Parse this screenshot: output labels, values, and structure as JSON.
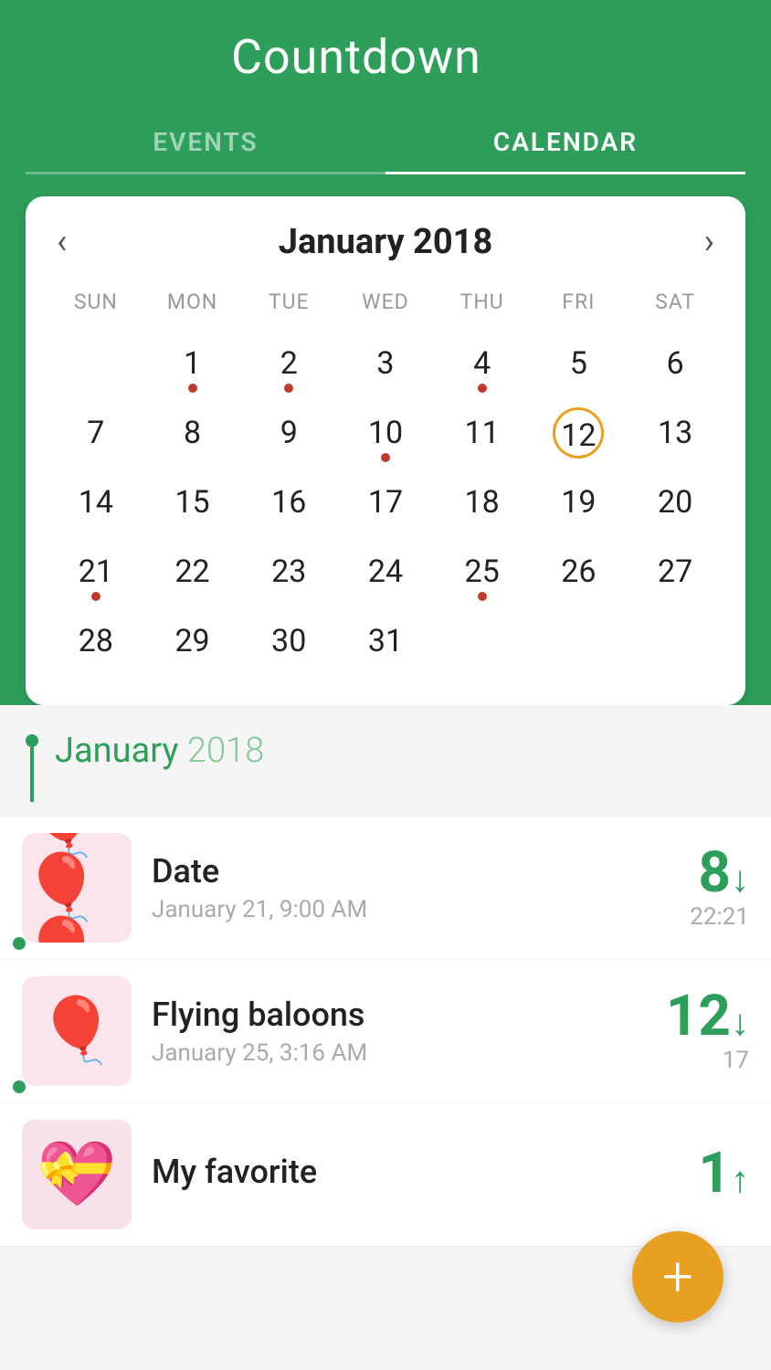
{
  "header": {
    "title": "Countdown",
    "icon_hamburger": "☰",
    "icon_check_cloud": "✓",
    "icon_palette": "🎨",
    "icon_filter": "≡"
  },
  "tabs": [
    {
      "id": "events",
      "label": "EVENTS",
      "active": false
    },
    {
      "id": "calendar",
      "label": "CALENDAR",
      "active": true
    }
  ],
  "calendar": {
    "month_title": "January 2018",
    "prev_label": "‹",
    "next_label": "›",
    "weekdays": [
      "SUN",
      "MON",
      "TUE",
      "WED",
      "THU",
      "FRI",
      "SAT"
    ],
    "today_day": 12,
    "weeks": [
      [
        null,
        1,
        2,
        3,
        4,
        5,
        6
      ],
      [
        7,
        8,
        9,
        10,
        11,
        12,
        13
      ],
      [
        14,
        15,
        16,
        17,
        18,
        19,
        20
      ],
      [
        21,
        22,
        23,
        24,
        25,
        26,
        27
      ],
      [
        28,
        29,
        30,
        31,
        null,
        null,
        null
      ]
    ],
    "dots": [
      1,
      2,
      4,
      10,
      21,
      25
    ]
  },
  "events_section": {
    "month_label": "January",
    "year_label": "2018"
  },
  "events": [
    {
      "id": "date-event",
      "title": "Date",
      "date": "January 21, 9:00 AM",
      "countdown_num": "8",
      "countdown_arrow": "↓",
      "countdown_time": "22:21",
      "emoji": "🎈"
    },
    {
      "id": "flying-baloons",
      "title": "Flying baloons",
      "date": "January 25, 3:16 AM",
      "countdown_num": "12",
      "countdown_arrow": "↓",
      "countdown_time": "17",
      "emoji": "🎈"
    },
    {
      "id": "my-favorite",
      "title": "My favorite",
      "date": "",
      "countdown_num": "1",
      "countdown_arrow": "↑",
      "countdown_time": "",
      "emoji": "💝"
    }
  ],
  "fab": {
    "label": "+"
  }
}
